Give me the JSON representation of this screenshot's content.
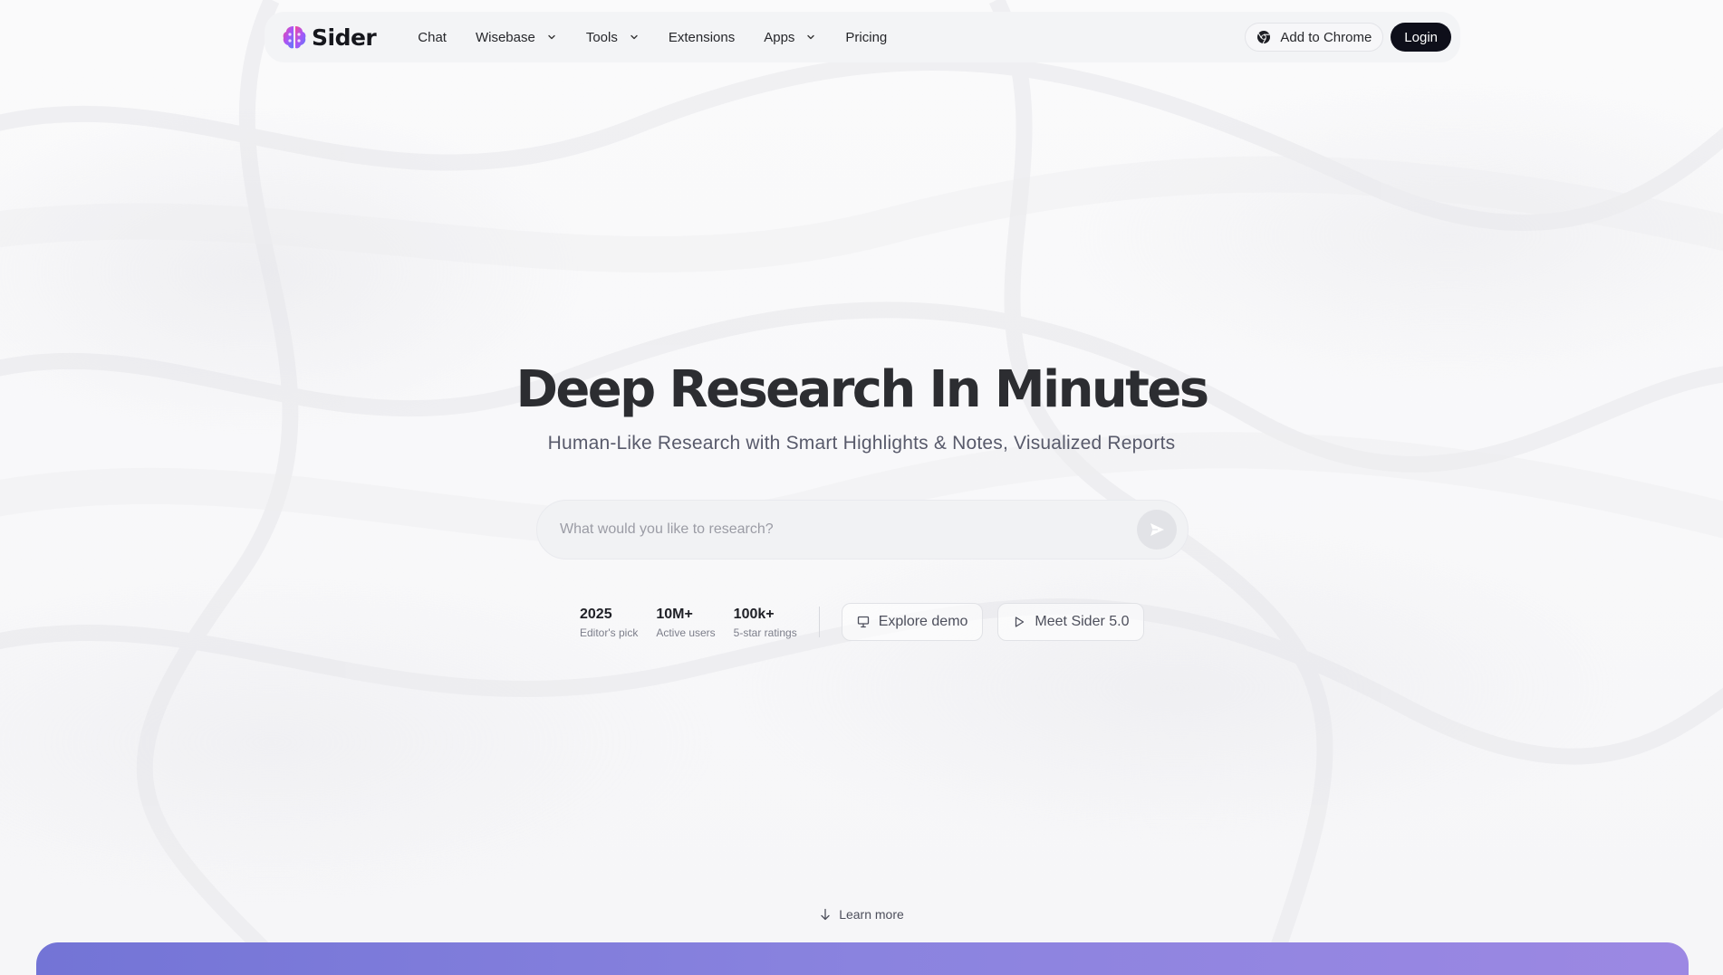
{
  "brand": {
    "name": "Sider",
    "logo_icon": "brain-logo-icon"
  },
  "nav": {
    "items": [
      {
        "label": "Chat",
        "has_dropdown": false
      },
      {
        "label": "Wisebase",
        "has_dropdown": true
      },
      {
        "label": "Tools",
        "has_dropdown": true
      },
      {
        "label": "Extensions",
        "has_dropdown": false
      },
      {
        "label": "Apps",
        "has_dropdown": true
      },
      {
        "label": "Pricing",
        "has_dropdown": false
      }
    ],
    "add_to_chrome": "Add to Chrome",
    "login": "Login"
  },
  "hero": {
    "title": "Deep Research In Minutes",
    "subtitle": "Human-Like Research with Smart Highlights & Notes, Visualized Reports"
  },
  "search": {
    "placeholder": "What would you like to research?",
    "value": ""
  },
  "stats": [
    {
      "value": "2025",
      "label": "Editor's pick"
    },
    {
      "value": "10M+",
      "label": "Active users"
    },
    {
      "value": "100k+",
      "label": "5-star ratings"
    }
  ],
  "actions": {
    "explore_demo": "Explore demo",
    "meet_sider": "Meet Sider 5.0"
  },
  "learn_more": "Learn more",
  "colors": {
    "login_bg": "#0e0f1a",
    "band_start": "#7374d6",
    "band_end": "#9c88e3"
  }
}
